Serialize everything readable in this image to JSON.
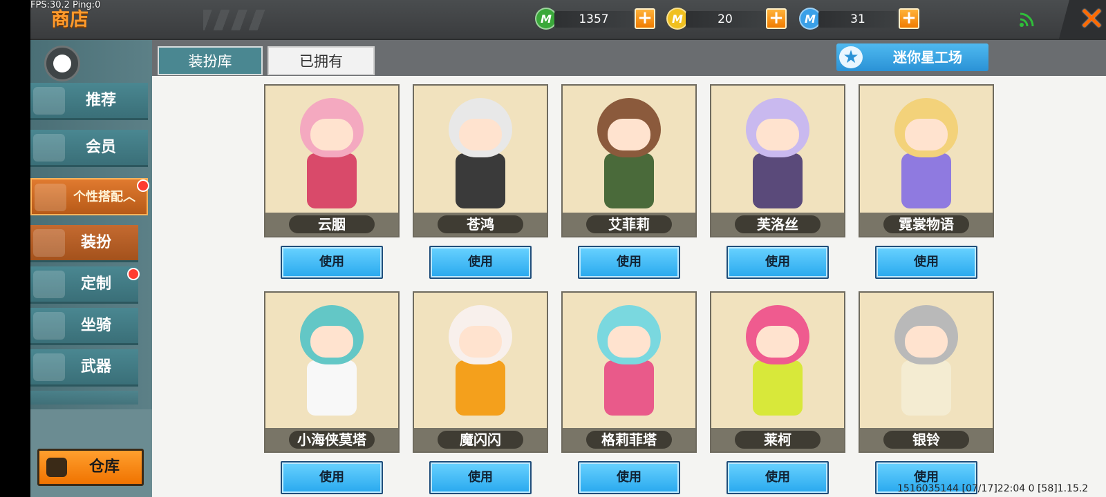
{
  "debug": {
    "fps": "FPS:30.2  Ping:0"
  },
  "header": {
    "title": "商店",
    "currencies": [
      {
        "icon": "green-gem-icon",
        "value": "1357",
        "color": "#3aa83a"
      },
      {
        "icon": "gold-coin-icon",
        "value": "20",
        "color": "#f0c020"
      },
      {
        "icon": "blue-coin-icon",
        "value": "31",
        "color": "#3aa0e8"
      }
    ]
  },
  "sidebar": {
    "items": [
      {
        "label": "推荐",
        "icon": "thumbs-up-icon"
      },
      {
        "label": "会员",
        "icon": "vip-icon"
      },
      {
        "label": "个性搭配",
        "icon": "trophy-icon"
      },
      {
        "label": "装扮",
        "icon": "shirt-icon"
      },
      {
        "label": "定制",
        "icon": "pencil-icon"
      },
      {
        "label": "坐骑",
        "icon": "mount-icon"
      },
      {
        "label": "武器",
        "icon": "gun-icon"
      }
    ],
    "warehouse_label": "仓库"
  },
  "tabs": [
    {
      "label": "装扮库"
    },
    {
      "label": "已拥有"
    }
  ],
  "workshop_label": "迷你星工场",
  "use_label": "使用",
  "skins": [
    {
      "name": "云胭",
      "colors": [
        "#f4a9c0",
        "#d94a6a"
      ]
    },
    {
      "name": "苍鸿",
      "colors": [
        "#e8e8e8",
        "#3a3a3a"
      ]
    },
    {
      "name": "艾菲莉",
      "colors": [
        "#8b5a3c",
        "#4a6a3a"
      ]
    },
    {
      "name": "芙洛丝",
      "colors": [
        "#c9b9ef",
        "#5a4a7a"
      ]
    },
    {
      "name": "霓裳物语",
      "colors": [
        "#f3d27a",
        "#8f7ae0"
      ]
    },
    {
      "name": "小海侠莫塔",
      "colors": [
        "#63c7c6",
        "#f8f8f8"
      ]
    },
    {
      "name": "魔闪闪",
      "colors": [
        "#f8f0ec",
        "#f4a01c"
      ]
    },
    {
      "name": "格莉菲塔",
      "colors": [
        "#7ad8df",
        "#e95a8a"
      ]
    },
    {
      "name": "莱柯",
      "colors": [
        "#ef5b8f",
        "#d8e83a"
      ]
    },
    {
      "name": "银铃",
      "colors": [
        "#b9b9b9",
        "#f4ecd2"
      ]
    }
  ],
  "footer": {
    "info": "1516035144     [07/17]22:04 0    [58]1.15.2"
  }
}
